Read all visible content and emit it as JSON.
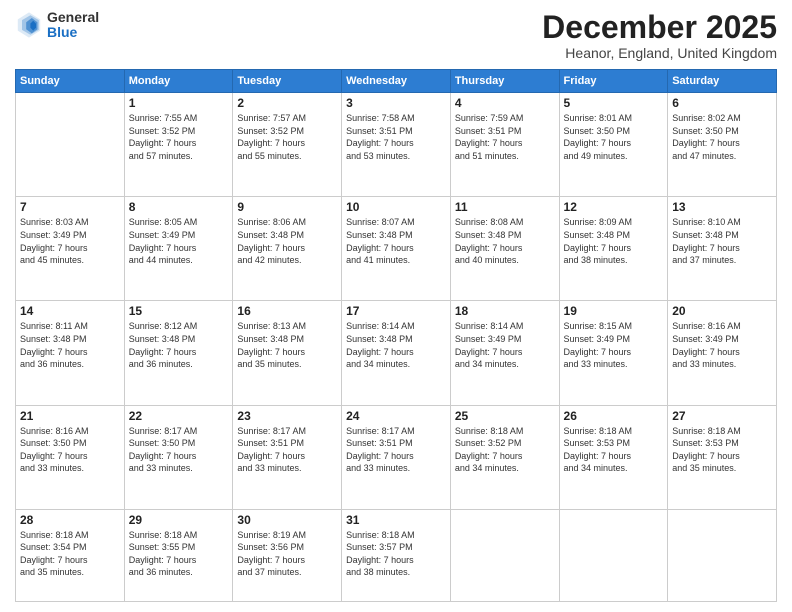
{
  "header": {
    "logo": {
      "general": "General",
      "blue": "Blue"
    },
    "title": "December 2025",
    "location": "Heanor, England, United Kingdom"
  },
  "calendar": {
    "days": [
      "Sunday",
      "Monday",
      "Tuesday",
      "Wednesday",
      "Thursday",
      "Friday",
      "Saturday"
    ],
    "weeks": [
      [
        {
          "day": "",
          "info": ""
        },
        {
          "day": "1",
          "info": "Sunrise: 7:55 AM\nSunset: 3:52 PM\nDaylight: 7 hours\nand 57 minutes."
        },
        {
          "day": "2",
          "info": "Sunrise: 7:57 AM\nSunset: 3:52 PM\nDaylight: 7 hours\nand 55 minutes."
        },
        {
          "day": "3",
          "info": "Sunrise: 7:58 AM\nSunset: 3:51 PM\nDaylight: 7 hours\nand 53 minutes."
        },
        {
          "day": "4",
          "info": "Sunrise: 7:59 AM\nSunset: 3:51 PM\nDaylight: 7 hours\nand 51 minutes."
        },
        {
          "day": "5",
          "info": "Sunrise: 8:01 AM\nSunset: 3:50 PM\nDaylight: 7 hours\nand 49 minutes."
        },
        {
          "day": "6",
          "info": "Sunrise: 8:02 AM\nSunset: 3:50 PM\nDaylight: 7 hours\nand 47 minutes."
        }
      ],
      [
        {
          "day": "7",
          "info": "Sunrise: 8:03 AM\nSunset: 3:49 PM\nDaylight: 7 hours\nand 45 minutes."
        },
        {
          "day": "8",
          "info": "Sunrise: 8:05 AM\nSunset: 3:49 PM\nDaylight: 7 hours\nand 44 minutes."
        },
        {
          "day": "9",
          "info": "Sunrise: 8:06 AM\nSunset: 3:48 PM\nDaylight: 7 hours\nand 42 minutes."
        },
        {
          "day": "10",
          "info": "Sunrise: 8:07 AM\nSunset: 3:48 PM\nDaylight: 7 hours\nand 41 minutes."
        },
        {
          "day": "11",
          "info": "Sunrise: 8:08 AM\nSunset: 3:48 PM\nDaylight: 7 hours\nand 40 minutes."
        },
        {
          "day": "12",
          "info": "Sunrise: 8:09 AM\nSunset: 3:48 PM\nDaylight: 7 hours\nand 38 minutes."
        },
        {
          "day": "13",
          "info": "Sunrise: 8:10 AM\nSunset: 3:48 PM\nDaylight: 7 hours\nand 37 minutes."
        }
      ],
      [
        {
          "day": "14",
          "info": "Sunrise: 8:11 AM\nSunset: 3:48 PM\nDaylight: 7 hours\nand 36 minutes."
        },
        {
          "day": "15",
          "info": "Sunrise: 8:12 AM\nSunset: 3:48 PM\nDaylight: 7 hours\nand 36 minutes."
        },
        {
          "day": "16",
          "info": "Sunrise: 8:13 AM\nSunset: 3:48 PM\nDaylight: 7 hours\nand 35 minutes."
        },
        {
          "day": "17",
          "info": "Sunrise: 8:14 AM\nSunset: 3:48 PM\nDaylight: 7 hours\nand 34 minutes."
        },
        {
          "day": "18",
          "info": "Sunrise: 8:14 AM\nSunset: 3:49 PM\nDaylight: 7 hours\nand 34 minutes."
        },
        {
          "day": "19",
          "info": "Sunrise: 8:15 AM\nSunset: 3:49 PM\nDaylight: 7 hours\nand 33 minutes."
        },
        {
          "day": "20",
          "info": "Sunrise: 8:16 AM\nSunset: 3:49 PM\nDaylight: 7 hours\nand 33 minutes."
        }
      ],
      [
        {
          "day": "21",
          "info": "Sunrise: 8:16 AM\nSunset: 3:50 PM\nDaylight: 7 hours\nand 33 minutes."
        },
        {
          "day": "22",
          "info": "Sunrise: 8:17 AM\nSunset: 3:50 PM\nDaylight: 7 hours\nand 33 minutes."
        },
        {
          "day": "23",
          "info": "Sunrise: 8:17 AM\nSunset: 3:51 PM\nDaylight: 7 hours\nand 33 minutes."
        },
        {
          "day": "24",
          "info": "Sunrise: 8:17 AM\nSunset: 3:51 PM\nDaylight: 7 hours\nand 33 minutes."
        },
        {
          "day": "25",
          "info": "Sunrise: 8:18 AM\nSunset: 3:52 PM\nDaylight: 7 hours\nand 34 minutes."
        },
        {
          "day": "26",
          "info": "Sunrise: 8:18 AM\nSunset: 3:53 PM\nDaylight: 7 hours\nand 34 minutes."
        },
        {
          "day": "27",
          "info": "Sunrise: 8:18 AM\nSunset: 3:53 PM\nDaylight: 7 hours\nand 35 minutes."
        }
      ],
      [
        {
          "day": "28",
          "info": "Sunrise: 8:18 AM\nSunset: 3:54 PM\nDaylight: 7 hours\nand 35 minutes."
        },
        {
          "day": "29",
          "info": "Sunrise: 8:18 AM\nSunset: 3:55 PM\nDaylight: 7 hours\nand 36 minutes."
        },
        {
          "day": "30",
          "info": "Sunrise: 8:19 AM\nSunset: 3:56 PM\nDaylight: 7 hours\nand 37 minutes."
        },
        {
          "day": "31",
          "info": "Sunrise: 8:18 AM\nSunset: 3:57 PM\nDaylight: 7 hours\nand 38 minutes."
        },
        {
          "day": "",
          "info": ""
        },
        {
          "day": "",
          "info": ""
        },
        {
          "day": "",
          "info": ""
        }
      ]
    ]
  }
}
